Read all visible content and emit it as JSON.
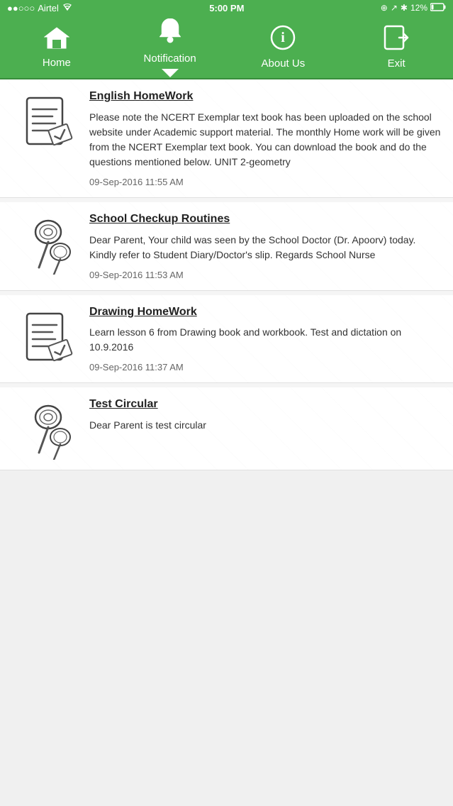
{
  "statusBar": {
    "carrier": "Airtel",
    "time": "5:00 PM",
    "battery": "12%",
    "signal_dots": "●●○○○"
  },
  "navBar": {
    "items": [
      {
        "id": "home",
        "label": "Home",
        "icon": "🏠"
      },
      {
        "id": "notification",
        "label": "Notification",
        "icon": "🔔",
        "active": true
      },
      {
        "id": "about",
        "label": "About Us",
        "icon": "ℹ"
      },
      {
        "id": "exit",
        "label": "Exit",
        "icon": "⎋"
      }
    ]
  },
  "notifications": [
    {
      "id": "english-homework",
      "title": "English HomeWork",
      "text": "Please note the NCERT Exemplar text book has been uploaded on the school website under Academic support material. The monthly Home work will be given from the NCERT Exemplar text book. You can download the book and do the questions mentioned below. UNIT 2-geometry",
      "date": "09-Sep-2016 11:55 AM",
      "icon": "document"
    },
    {
      "id": "school-checkup",
      "title": "School Checkup Routines",
      "text": "Dear Parent, Your child was seen by the School Doctor (Dr. Apoorv) today. Kindly refer to Student Diary/Doctor's slip. Regards School Nurse",
      "date": "09-Sep-2016 11:53 AM",
      "icon": "pin"
    },
    {
      "id": "drawing-homework",
      "title": "Drawing HomeWork",
      "text": "Learn lesson 6 from Drawing book and workbook. Test and dictation on 10.9.2016",
      "date": "09-Sep-2016 11:37 AM",
      "icon": "document"
    },
    {
      "id": "test-circular",
      "title": "Test Circular",
      "text": "Dear Parent is test circular",
      "date": "",
      "icon": "pin"
    }
  ]
}
